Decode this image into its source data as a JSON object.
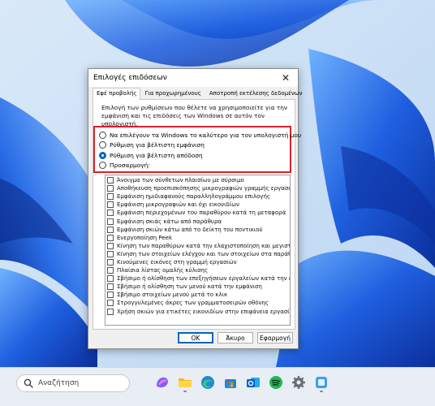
{
  "dialog": {
    "title": "Επιλογές επιδόσεων",
    "close_glyph": "✕",
    "tabs": [
      {
        "label": "Εφέ προβολής",
        "active": true
      },
      {
        "label": "Για προχωρημένους",
        "active": false
      },
      {
        "label": "Αποτροπή εκτέλεσης δεδομένων",
        "active": false
      }
    ],
    "description": "Επιλογή των ρυθμίσεων που θέλετε να χρησιμοποιείτε για την εμφάνιση και τις επιδόσεις των Windows σε αυτόν τον υπολογιστή.",
    "radios": [
      {
        "label": "Να επιλέγουν τα Windows το καλύτερο για τον υπολογιστή μου",
        "checked": false
      },
      {
        "label": "Ρύθμιση για βέλτιστη εμφάνιση",
        "checked": false
      },
      {
        "label": "Ρύθμιση για βέλτιστη απόδοση",
        "checked": true
      },
      {
        "label": "Προσαρμογή:",
        "checked": false
      }
    ],
    "checkboxes": [
      {
        "label": "Άνοιγμα των σύνθετων πλαισίων με σύρσιμο",
        "checked": false
      },
      {
        "label": "Αποθήκευση προεπισκόπησης μικρογραφιών γραμμής εργασιών",
        "checked": false
      },
      {
        "label": "Εμφάνιση ημιδιαφανούς παραλληλογράμμου επιλογής",
        "checked": false
      },
      {
        "label": "Εμφάνιση μικρογραφιών και όχι εικονιδίων",
        "checked": false
      },
      {
        "label": "Εμφάνιση περιεχομένων του παραθύρου κατά τη μεταφορά",
        "checked": false
      },
      {
        "label": "Εμφάνιση σκιάς κάτω από παράθυρα",
        "checked": false
      },
      {
        "label": "Εμφάνιση σκιών κάτω από το δείκτη του ποντικιού",
        "checked": false
      },
      {
        "label": "Ενεργοποίηση Peek",
        "checked": false
      },
      {
        "label": "Κίνηση των παραθύρων κατά την ελαχιστοποίηση και μεγιστοποίηση",
        "checked": false
      },
      {
        "label": "Κίνηση των στοιχείων ελέγχου και των στοιχείων στα παράθυρα",
        "checked": false
      },
      {
        "label": "Κινούμενες εικόνες στη γραμμή εργασιών",
        "checked": false
      },
      {
        "label": "Πλαίσια λίστας ομαλής κύλισης",
        "checked": false
      },
      {
        "label": "Σβήσιμο ή ολίσθηση των επεξηγήσεων εργαλείων κατά την εμφάνιση",
        "checked": false
      },
      {
        "label": "Σβήσιμο ή ολίσθηση των μενού κατά την εμφάνιση",
        "checked": false
      },
      {
        "label": "Σβήσιμο στοιχείων μενού μετά το κλικ",
        "checked": false
      },
      {
        "label": "Στρογγυλεμένες άκρες των γραμματοσειρών οθόνης",
        "checked": false
      },
      {
        "label": "Χρήση σκιών για ετικέτες εικονιδίων στην επιφάνεια εργασίας",
        "checked": false
      }
    ],
    "buttons": {
      "ok": "OK",
      "cancel": "Άκυρο",
      "apply": "Εφαρμογή"
    }
  },
  "taskbar": {
    "search_placeholder": "Αναζήτηση",
    "apps": [
      {
        "icon": "copilot-icon",
        "color": "#7b61ff"
      },
      {
        "icon": "file-explorer-icon",
        "color": "#f2b81c"
      },
      {
        "icon": "edge-icon",
        "color": "#1f8ad6"
      },
      {
        "icon": "microsoft-store-icon",
        "color": "#2d7ed8"
      },
      {
        "icon": "outlook-icon",
        "color": "#0b62c4"
      },
      {
        "icon": "spotify-icon",
        "color": "#1db954"
      },
      {
        "icon": "settings-icon",
        "color": "#6b6f75"
      },
      {
        "icon": "app-icon",
        "color": "#3aa0e8"
      }
    ]
  },
  "colors": {
    "highlight_border": "#d9212a",
    "accent": "#0067c0",
    "wallpaper_blue": "#1e5fd6"
  }
}
